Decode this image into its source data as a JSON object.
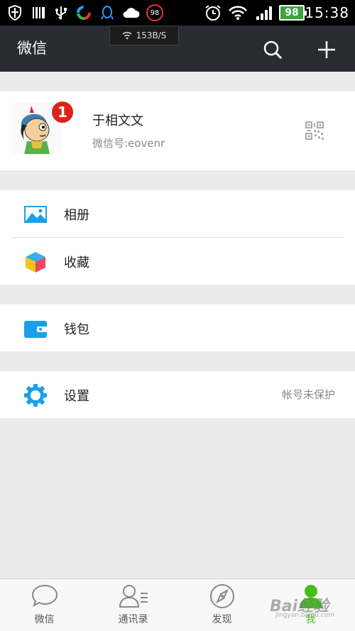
{
  "status_bar": {
    "time": "15:38",
    "battery": "98",
    "notification_count": "98",
    "icons": [
      "shield-icon",
      "barcode-icon",
      "usb-icon",
      "sync-icon",
      "qq-icon",
      "cloud-icon",
      "alarm-icon",
      "wifi-icon",
      "signal-icon"
    ]
  },
  "header": {
    "title": "微信",
    "speed": "153B/S",
    "search_icon": "search-icon",
    "add_icon": "plus-icon"
  },
  "profile": {
    "name": "于相文文",
    "wechat_id": "微信号:eovenr",
    "notification_badge": "1",
    "qr_icon": "qr-code-icon"
  },
  "menu": {
    "album": "相册",
    "favorites": "收藏",
    "wallet": "钱包",
    "settings": "设置",
    "settings_status": "帐号未保护"
  },
  "tabs": [
    {
      "label": "微信",
      "icon": "chat-icon"
    },
    {
      "label": "通讯录",
      "icon": "contacts-icon"
    },
    {
      "label": "发现",
      "icon": "compass-icon"
    },
    {
      "label": "我",
      "icon": "me-icon"
    }
  ],
  "watermark": {
    "text": "Bai经验",
    "sub": "jingyan.baidu.com"
  },
  "colors": {
    "header": "#292c33",
    "accent_green": "#45c01a",
    "badge_red": "#e0211a",
    "album_blue": "#1aa0e8"
  }
}
